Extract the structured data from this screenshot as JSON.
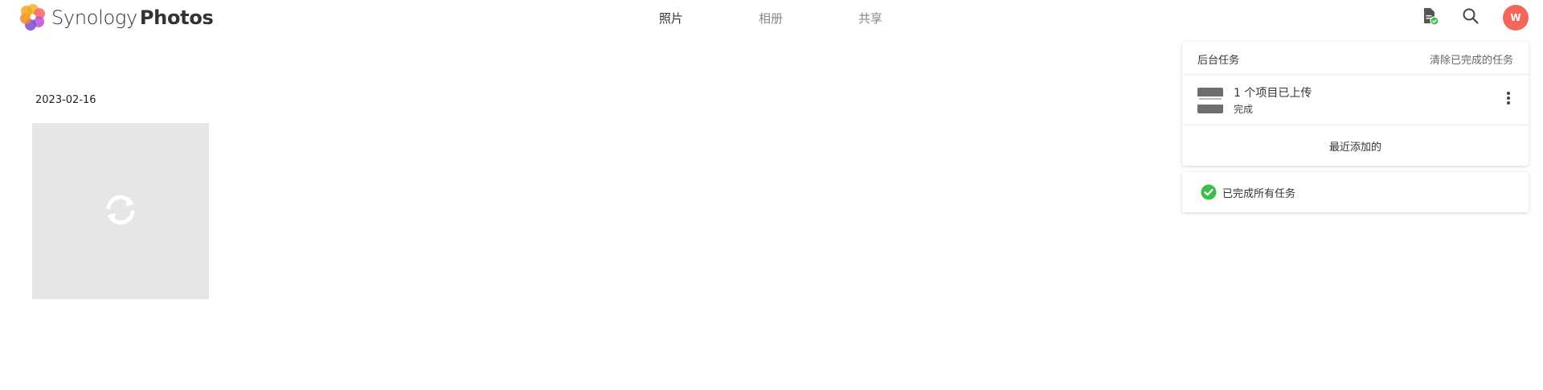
{
  "header": {
    "brand_light": "Synology",
    "brand_bold": "Photos",
    "tabs": [
      {
        "label": "照片",
        "active": true
      },
      {
        "label": "相册",
        "active": false
      },
      {
        "label": "共享",
        "active": false
      }
    ],
    "icons": {
      "tasks": "task-document-check-icon",
      "search": "search-icon"
    },
    "avatar_letter": "W",
    "avatar_color": "#f4655a"
  },
  "main": {
    "date_label": "2023-02-16",
    "thumbnail_icon": "sync-loading-icon"
  },
  "tasks_panel": {
    "title": "后台任务",
    "clear_label": "清除已完成的任务",
    "task": {
      "name": "1 个项目已上传",
      "status": "完成"
    },
    "footer_label": "最近添加的"
  },
  "summary_panel": {
    "text": "已完成所有任务",
    "check_color": "#3cbf4a"
  }
}
